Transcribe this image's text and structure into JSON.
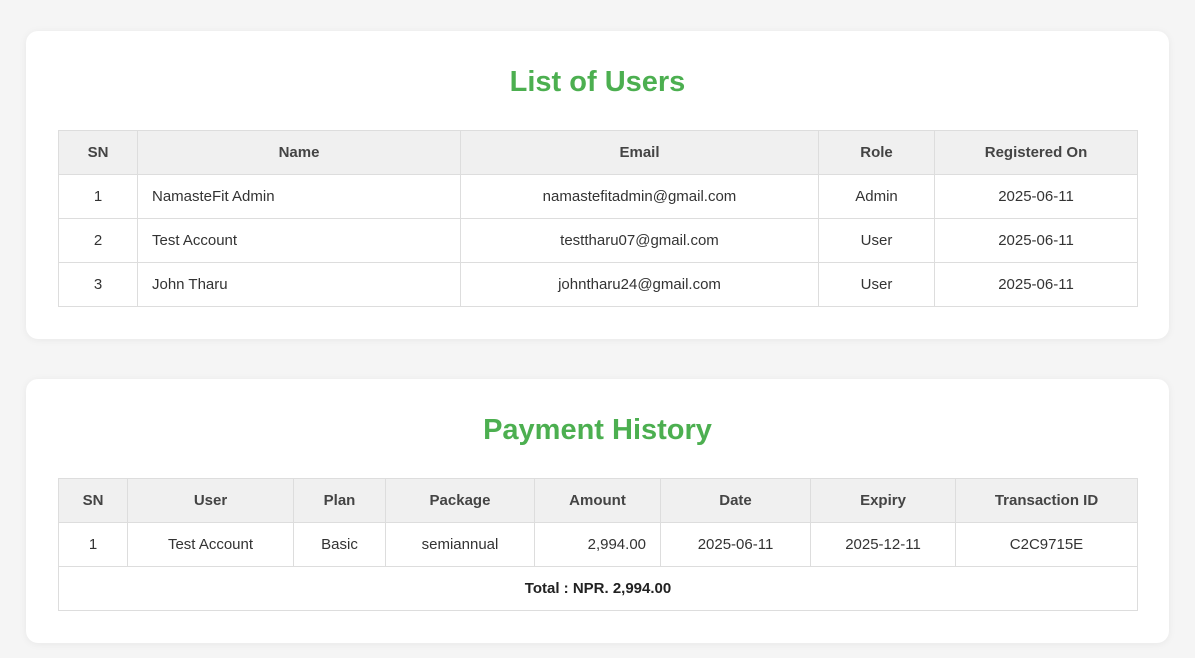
{
  "theme": {
    "accent": "#4caf50",
    "card_bg": "#ffffff",
    "page_bg": "#f5f5f5"
  },
  "users_section": {
    "title": "List of Users",
    "headers": [
      "SN",
      "Name",
      "Email",
      "Role",
      "Registered On"
    ],
    "rows": [
      {
        "sn": "1",
        "name": "NamasteFit Admin",
        "email": "namastefitadmin@gmail.com",
        "role": "Admin",
        "registered": "2025-06-11"
      },
      {
        "sn": "2",
        "name": "Test Account",
        "email": "testtharu07@gmail.com",
        "role": "User",
        "registered": "2025-06-11"
      },
      {
        "sn": "3",
        "name": "John Tharu",
        "email": "johntharu24@gmail.com",
        "role": "User",
        "registered": "2025-06-11"
      }
    ]
  },
  "payments_section": {
    "title": "Payment History",
    "headers": [
      "SN",
      "User",
      "Plan",
      "Package",
      "Amount",
      "Date",
      "Expiry",
      "Transaction ID"
    ],
    "rows": [
      {
        "sn": "1",
        "user": "Test Account",
        "plan": "Basic",
        "package": "semiannual",
        "amount": "2,994.00",
        "date": "2025-06-11",
        "expiry": "2025-12-11",
        "txn": "C2C9715E"
      }
    ],
    "total": "Total : NPR. 2,994.00"
  }
}
